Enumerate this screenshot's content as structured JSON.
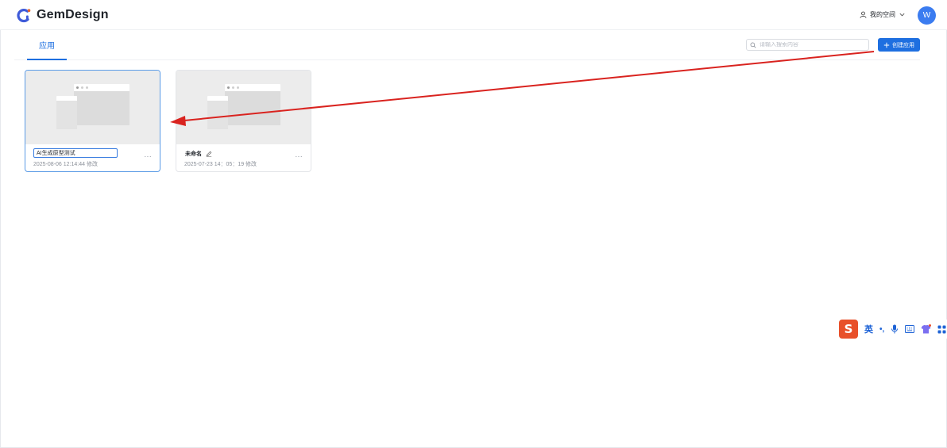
{
  "app": {
    "brand": "GemDesign"
  },
  "header": {
    "workspace_label": "我的空间",
    "avatar_letter": "W"
  },
  "tabs": [
    {
      "label": "应用"
    }
  ],
  "search": {
    "placeholder": "请输入搜索内容"
  },
  "create_button": {
    "label": "创建应用"
  },
  "cards": [
    {
      "name": "AI生成原型测试",
      "meta": "2025-08-06 12:14:44 修改",
      "editing": true
    },
    {
      "name": "未命名",
      "meta": "2025-07-23 14：05：19 修改",
      "editing": false
    }
  ],
  "ime": {
    "logo": "S",
    "lang": "英",
    "punct": "•,",
    "icons": [
      "microphone-icon",
      "keyboard-icon",
      "skin-icon",
      "toolbox-icon"
    ]
  },
  "colors": {
    "primary": "#1e6fe0",
    "avatar": "#3b7cf0",
    "arrow": "#d9231f",
    "ime_logo": "#e8502a"
  }
}
